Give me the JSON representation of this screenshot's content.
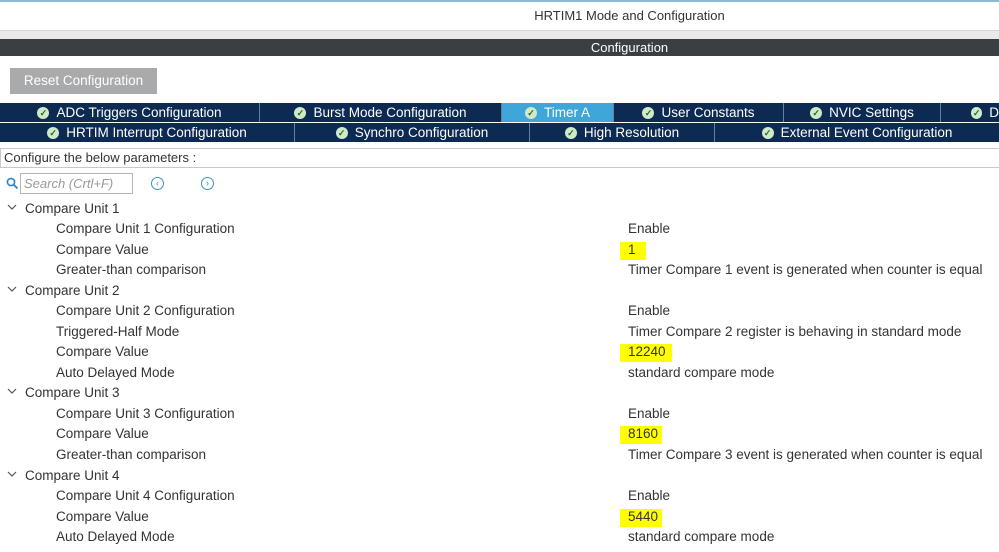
{
  "window": {
    "title": "HRTIM1 Mode and Configuration"
  },
  "section_header": "Configuration",
  "reset_button": "Reset Configuration",
  "tabs_row1": [
    {
      "label": "ADC Triggers Configuration",
      "active": false,
      "icon": "check-circle-icon"
    },
    {
      "label": "Burst Mode Configuration",
      "active": false,
      "icon": "check-circle-icon"
    },
    {
      "label": "Timer A",
      "active": true,
      "icon": "check-circle-icon"
    },
    {
      "label": "User Constants",
      "active": false,
      "icon": "check-circle-icon"
    },
    {
      "label": "NVIC Settings",
      "active": false,
      "icon": "check-circle-icon"
    },
    {
      "label": "D",
      "active": false,
      "icon": "check-circle-icon"
    }
  ],
  "tabs_row2": [
    {
      "label": "HRTIM Interrupt Configuration",
      "icon": "check-circle-icon"
    },
    {
      "label": "Synchro Configuration",
      "icon": "check-circle-icon"
    },
    {
      "label": "High Resolution",
      "icon": "check-circle-icon"
    },
    {
      "label": "External Event Configuration",
      "icon": "check-circle-icon"
    }
  ],
  "params_label": "Configure the below parameters :",
  "search": {
    "placeholder": "Search (Crtl+F)"
  },
  "highlight_color": "#ffff00",
  "groups": [
    {
      "label": "Compare Unit 1",
      "params": [
        {
          "name": "Compare Unit 1 Configuration",
          "value": "Enable",
          "highlight": false
        },
        {
          "name": "Compare Value",
          "value": "1",
          "highlight": true
        },
        {
          "name": "Greater-than comparison",
          "value": "Timer Compare 1 event is generated when counter is equal",
          "highlight": false
        }
      ]
    },
    {
      "label": "Compare Unit 2",
      "params": [
        {
          "name": "Compare Unit 2 Configuration",
          "value": "Enable",
          "highlight": false
        },
        {
          "name": "Triggered-Half Mode",
          "value": "Timer Compare 2 register is behaving in standard mode",
          "highlight": false
        },
        {
          "name": "Compare Value",
          "value": "12240",
          "highlight": true
        },
        {
          "name": "Auto Delayed Mode",
          "value": "standard compare mode",
          "highlight": false
        }
      ]
    },
    {
      "label": "Compare Unit 3",
      "params": [
        {
          "name": "Compare Unit 3 Configuration",
          "value": "Enable",
          "highlight": false
        },
        {
          "name": "Compare Value",
          "value": "8160",
          "highlight": true
        },
        {
          "name": "Greater-than comparison",
          "value": "Timer Compare 3 event is generated when counter is equal",
          "highlight": false
        }
      ]
    },
    {
      "label": "Compare Unit 4",
      "params": [
        {
          "name": "Compare Unit 4 Configuration",
          "value": "Enable",
          "highlight": false
        },
        {
          "name": "Compare Value",
          "value": "5440",
          "highlight": true
        },
        {
          "name": "Auto Delayed Mode",
          "value": "standard compare mode",
          "highlight": false
        }
      ]
    }
  ]
}
